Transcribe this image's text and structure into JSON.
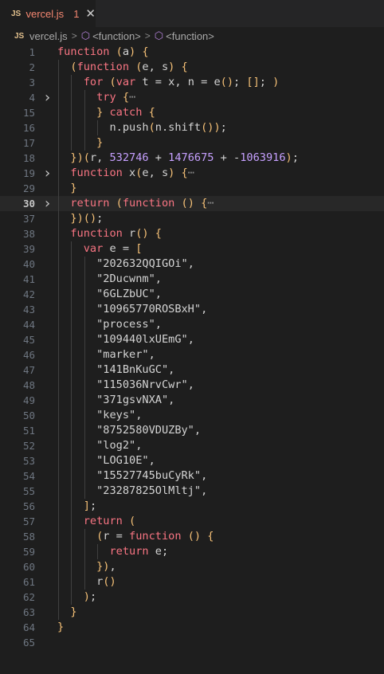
{
  "tab": {
    "badge": "JS",
    "filename": "vercel.js",
    "problems_count": "1",
    "close_glyph": "✕"
  },
  "breadcrumb": {
    "badge": "JS",
    "file": "vercel.js",
    "sep": ">",
    "symbol1": "<function>",
    "symbol2": "<function>"
  },
  "lines": [
    {
      "n": "1",
      "text": "function (a) {"
    },
    {
      "n": "2",
      "text": "  (function (e, s) {"
    },
    {
      "n": "3",
      "text": "    for (var t = x, n = e(); []; )"
    },
    {
      "n": "4",
      "text": "      try {⋯",
      "fold": true
    },
    {
      "n": "15",
      "text": "      } catch {"
    },
    {
      "n": "16",
      "text": "        n.push(n.shift());"
    },
    {
      "n": "17",
      "text": "      }"
    },
    {
      "n": "18",
      "text": "  })(r, 532746 + 1476675 + -1063916);"
    },
    {
      "n": "19",
      "text": "  function x(e, s) {⋯",
      "fold": true
    },
    {
      "n": "29",
      "text": "  }"
    },
    {
      "n": "30",
      "text": "  return (function () {⋯",
      "fold": true,
      "current": true
    },
    {
      "n": "37",
      "text": "  })();"
    },
    {
      "n": "38",
      "text": "  function r() {"
    },
    {
      "n": "39",
      "text": "    var e = ["
    },
    {
      "n": "40",
      "text": "      \"202632QQIGOi\","
    },
    {
      "n": "41",
      "text": "      \"2Ducwnm\","
    },
    {
      "n": "42",
      "text": "      \"6GLZbUC\","
    },
    {
      "n": "43",
      "text": "      \"10965770ROSBxH\","
    },
    {
      "n": "44",
      "text": "      \"process\","
    },
    {
      "n": "45",
      "text": "      \"109440lxUEmG\","
    },
    {
      "n": "46",
      "text": "      \"marker\","
    },
    {
      "n": "47",
      "text": "      \"141BnKuGC\","
    },
    {
      "n": "48",
      "text": "      \"115036NrvCwr\","
    },
    {
      "n": "49",
      "text": "      \"371gsvNXA\","
    },
    {
      "n": "50",
      "text": "      \"keys\","
    },
    {
      "n": "51",
      "text": "      \"8752580VDUZBy\","
    },
    {
      "n": "52",
      "text": "      \"log2\","
    },
    {
      "n": "53",
      "text": "      \"LOG10E\","
    },
    {
      "n": "54",
      "text": "      \"15527745buCyRk\","
    },
    {
      "n": "55",
      "text": "      \"23287825OlMltj\","
    },
    {
      "n": "56",
      "text": "    ];"
    },
    {
      "n": "57",
      "text": "    return ("
    },
    {
      "n": "58",
      "text": "      (r = function () {"
    },
    {
      "n": "59",
      "text": "        return e;"
    },
    {
      "n": "60",
      "text": "      }),"
    },
    {
      "n": "61",
      "text": "      r()"
    },
    {
      "n": "62",
      "text": "    );"
    },
    {
      "n": "63",
      "text": "  }"
    },
    {
      "n": "64",
      "text": "}"
    },
    {
      "n": "65",
      "text": ""
    }
  ]
}
